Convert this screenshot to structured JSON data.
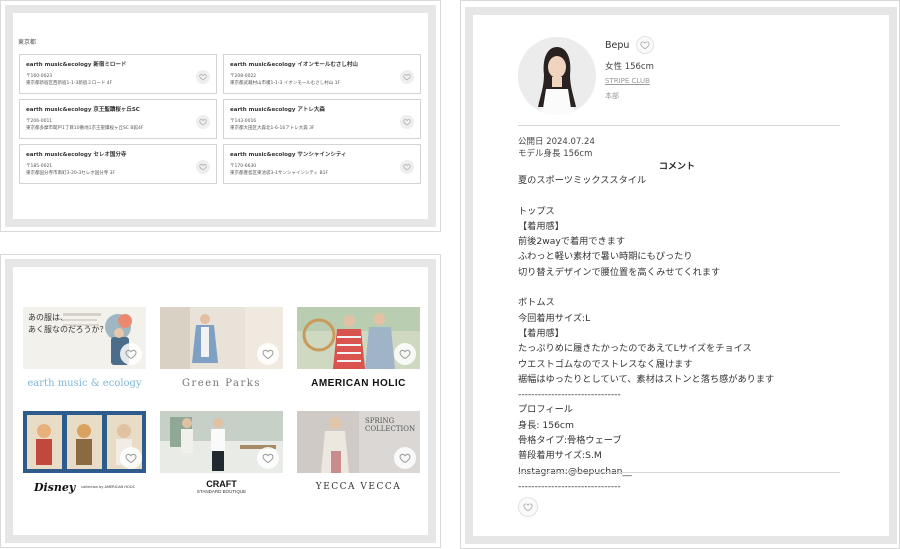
{
  "stores": {
    "region": "東京都",
    "items": [
      {
        "name": "earth music&ecology 新宿ミロード",
        "zip": "〒160-0023",
        "address": "東京都新宿区西新宿1-1-3新宿ミロード 4F"
      },
      {
        "name": "earth music&ecology イオンモールむさし村山",
        "zip": "〒208-0022",
        "address": "東京都武蔵村山市榎1-1-3 イオンモールむさし村山 1F"
      },
      {
        "name": "earth music&ecology 京王聖蹟桜ヶ丘SC",
        "zip": "〒206-0011",
        "address": "東京都多摩市関戸1丁目10番地1京王聖蹟桜ヶ丘SC B館4F"
      },
      {
        "name": "earth music&ecology アトレ大森",
        "zip": "〒143-0016",
        "address": "東京都大田区大森北1-6-16アトレ大森 3F"
      },
      {
        "name": "earth music&ecology セレオ国分寺",
        "zip": "〒185-0021",
        "address": "東京都国分寺市南町3-20-3セレオ国分寺 3F"
      },
      {
        "name": "earth music&ecology サンシャインシティ",
        "zip": "〒170-6630",
        "address": "東京都豊島区東池袋3-1サンシャインシティ B1F"
      }
    ]
  },
  "brands": [
    {
      "logo": "earth music & ecology",
      "img_text": "あの服は、\nあく服なのだろうか？"
    },
    {
      "logo": "Green Parks"
    },
    {
      "logo": "AMERICAN HOLIC"
    },
    {
      "logo": "Disney",
      "logo_sub": "collection by  AMERICAN HOLIC"
    },
    {
      "logo": "CRAFT",
      "logo_sub": "STANDARD BOUTIQUE"
    },
    {
      "logo": "YECCA VECCA",
      "img_text": "SPRING\nCOLLECTION"
    }
  ],
  "model": {
    "name": "Bepu",
    "meta": "女性  156cm",
    "brand_link": "STRIPE CLUB",
    "location": "本部"
  },
  "detail": {
    "published": "公開日  2024.07.24",
    "model_height": "モデル身長  156cm",
    "comment_title": "コメント",
    "body": "夏のスポーツミックススタイル\n\nトップス\n【着用感】\n前後2wayで着用できます\nふわっと軽い素材で暑い時期にもぴったり\n切り替えデザインで腰位置を高くみせてくれます\n\nボトムス\n今回着用サイズ:L\n【着用感】\nたっぷりめに履きたかったのであえてLサイズをチョイス\nウエストゴムなのでストレスなく履けます\n裾幅はゆったりとしていて、素材はストンと落ち感があります\n-------------------------------\nプロフィール\n身長: 156cm\n骨格タイプ:骨格ウェーブ\n普段着用サイズ:S.M\nInstagram:@bepuchan__\n-------------------------------"
  },
  "colors": {
    "border": "#e6e6e6",
    "heart_bg": "#eeeeee",
    "logo_blue": "#7fb7d9"
  }
}
